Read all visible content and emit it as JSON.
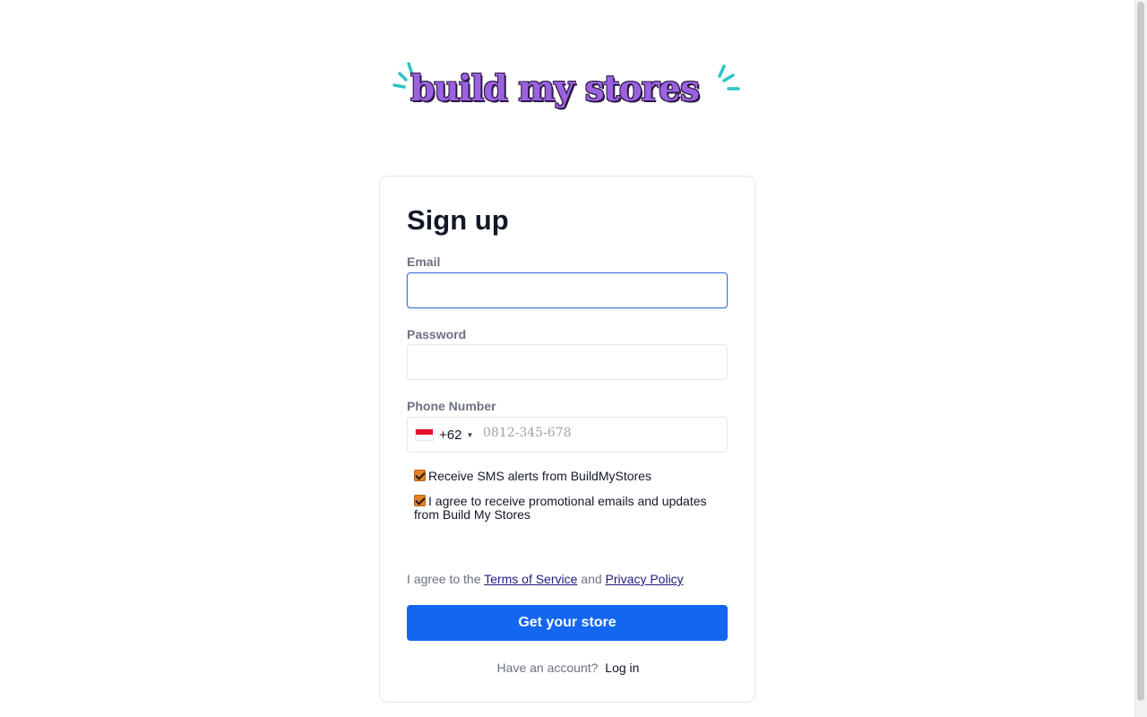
{
  "brand": {
    "logo_text": "build my stores"
  },
  "form": {
    "title": "Sign up",
    "email": {
      "label": "Email",
      "value": ""
    },
    "password": {
      "label": "Password",
      "value": ""
    },
    "phone": {
      "label": "Phone Number",
      "country_code": "+62",
      "country_flag": "indonesia-flag-icon",
      "placeholder": "0812-345-678"
    },
    "checkboxes": [
      {
        "label": "Receive SMS alerts from BuildMyStores",
        "checked": true
      },
      {
        "label": "I agree to receive promotional emails and updates from Build My Stores",
        "checked": true
      }
    ],
    "terms": {
      "prefix": "I agree to the",
      "terms_link": "Terms of Service",
      "conjunction": "and",
      "privacy_link": "Privacy Policy"
    },
    "submit_label": "Get your store",
    "footer": {
      "prompt": "Have an account?",
      "login_link": "Log in"
    }
  },
  "colors": {
    "accent": "#1266ef",
    "logo_purple": "#9b62e0",
    "logo_sparkle": "#2ec4c4",
    "checkbox": "#e67e22",
    "focus_border": "#3b6fd6"
  }
}
